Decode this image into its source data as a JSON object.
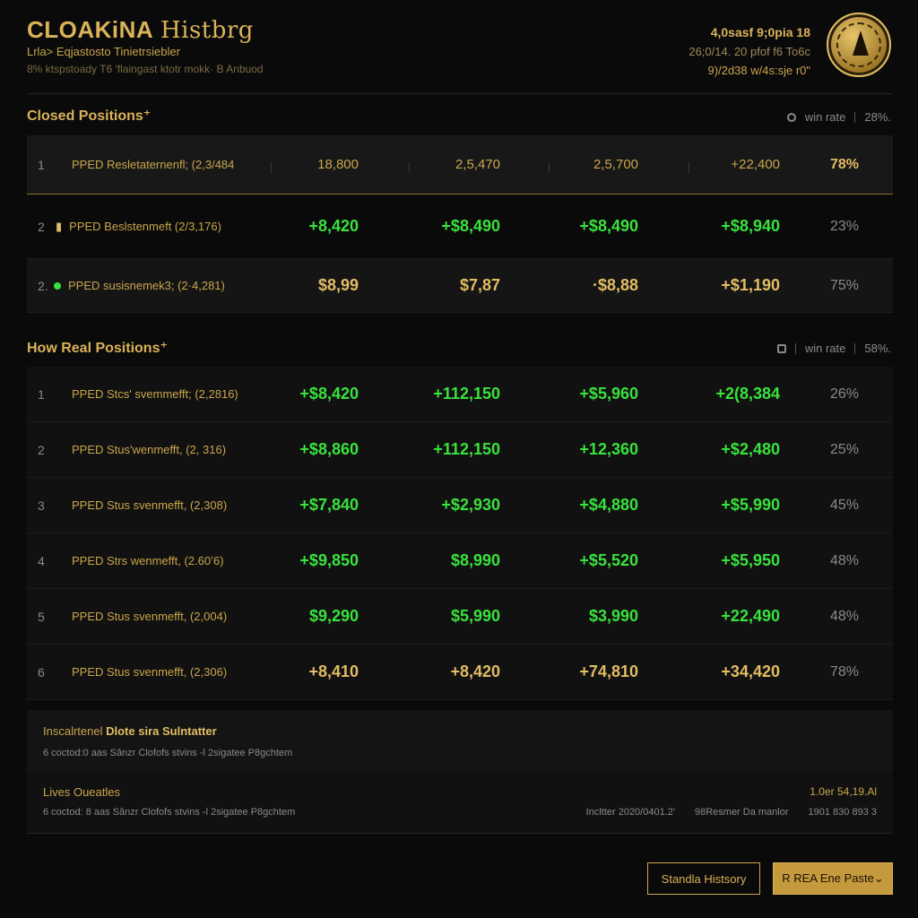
{
  "header": {
    "title_a": "CLOAKiNA",
    "title_b": "Histbrg",
    "sub1": "Lrla> Eqjastosto Tinietrsiebler",
    "sub2": "8% ktspstoady T6 'flaingast ktotr mokk· B Anbuod",
    "right_l1": "4,0sasf 9;0pia 18",
    "right_l2": "26;0/14. 20 pfof f6 To6c",
    "right_l3": "9)/2d38 w/4s:sje r0\""
  },
  "closed": {
    "title": "Closed Positions⁺",
    "meta_label": "win rate",
    "meta_value": "28%.",
    "rows": [
      {
        "idx": "1",
        "name": "PPED Resletaternenfl; (2,3/484",
        "v1": "18,800",
        "v2": "2,5,470",
        "v3": "2,5,700",
        "v4": "+22,400",
        "rate": "78%"
      },
      {
        "idx": "2",
        "name": "PPED Beslstenmeft (2/3,176)",
        "v1": "+8,420",
        "v2": "+$8,490",
        "v3": "+$8,490",
        "v4": "+$8,940",
        "rate": "23%"
      },
      {
        "idx": "2.",
        "name": "PPED susisnemek3; (2·4,281)",
        "v1": "$8,99",
        "v2": "$7,87",
        "v3": "·$8,88",
        "v4": "+$1,190",
        "rate": "75%"
      }
    ]
  },
  "real": {
    "title": "How Real Positions⁺",
    "meta_label": "win rate",
    "meta_value": "58%.",
    "rows": [
      {
        "idx": "1",
        "name": "PPED Stcs' svemmefft; (2,2816)",
        "v1": "+$8,420",
        "v2": "+112,150",
        "v3": "+$5,960",
        "v4": "+2(8,384",
        "rate": "26%"
      },
      {
        "idx": "2",
        "name": "PPED Stus'wenmefft, (2, 316)",
        "v1": "+$8,860",
        "v2": "+112,150",
        "v3": "+12,360",
        "v4": "+$2,480",
        "rate": "25%"
      },
      {
        "idx": "3",
        "name": "PPED Stus svenmefft, (2,308)",
        "v1": "+$7,840",
        "v2": "+$2,930",
        "v3": "+$4,880",
        "v4": "+$5,990",
        "rate": "45%"
      },
      {
        "idx": "4",
        "name": "PPED Strs wenmefft, (2.60ʼ6)",
        "v1": "+$9,850",
        "v2": "$8,990",
        "v3": "+$5,520",
        "v4": "+$5,950",
        "rate": "48%"
      },
      {
        "idx": "5",
        "name": "PPED Stus svenmefft, (2,004)",
        "v1": "$9,290",
        "v2": "$5,990",
        "v3": "$3,990",
        "v4": "+22,490",
        "rate": "48%"
      },
      {
        "idx": "6",
        "name": "PPED Stus svenmefft, (2,306)",
        "v1": "+8,410",
        "v2": "+8,420",
        "v3": "+74,810",
        "v4": "+34,420",
        "rate": "78%"
      }
    ]
  },
  "notes": {
    "n1_title_a": "Inscalrtenel",
    "n1_title_b": "Dlote sira Sulntatter",
    "n1_body": "6 coctod:0 aas Sânzr Clofofs stvins -l 2sigatee P8gchtem",
    "n2_title": "Lives Oueatles",
    "n2_body": "6 coctod: 8 aas Sânzr Clofofs stvins -l 2sigatee P8gchtem",
    "n2_right1": "1.0er 54,19.Al",
    "n2_right2a": "Incltter 2020/0401.2'",
    "n2_right2b": "98Resmer Da manlor",
    "n2_right2c": "1901 830 893 3"
  },
  "buttons": {
    "history": "Standla Histsory",
    "more": "R REA Ene Paste⌄"
  },
  "colors": {
    "accent": "#c9a64a",
    "profit": "#39e23c",
    "bg": "#0a0a0a"
  }
}
